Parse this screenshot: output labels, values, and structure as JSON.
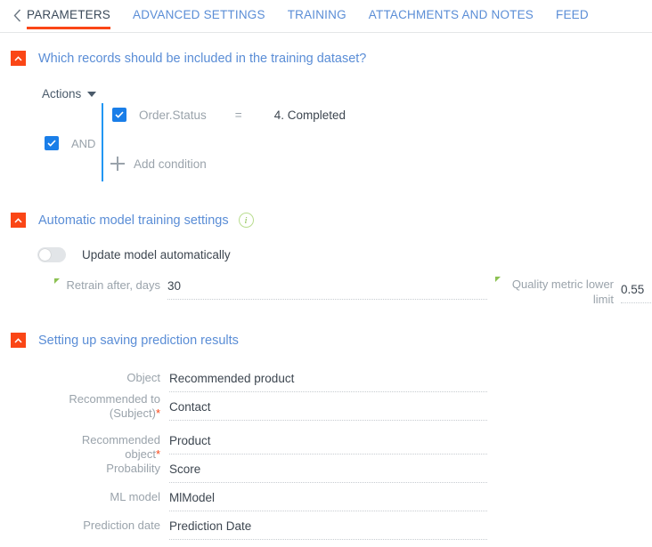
{
  "tabbar": {
    "back_icon": "chevron-left-icon",
    "tabs": [
      {
        "label": "PARAMETERS",
        "active": true
      },
      {
        "label": "ADVANCED SETTINGS",
        "active": false
      },
      {
        "label": "TRAINING",
        "active": false
      },
      {
        "label": "ATTACHMENTS AND NOTES",
        "active": false
      },
      {
        "label": "FEED",
        "active": false
      }
    ]
  },
  "colors": {
    "accent_orange": "#fa4616",
    "link_blue": "#5a8dd6",
    "checkbox_blue": "#1a7ee8",
    "rail_blue": "#2196f3",
    "green": "#8cc152",
    "label_gray": "#9aa3ab",
    "value_dark": "#3d4650"
  },
  "sections": {
    "training_dataset": {
      "title": "Which records should be included in the training dataset?",
      "collapse_icon": "chevron-up-icon",
      "actions_label": "Actions",
      "condition": {
        "checkbox_checked": true,
        "field": "Order.Status",
        "operator": "=",
        "value": "4. Completed"
      },
      "logical": {
        "checkbox_checked": true,
        "label": "AND"
      },
      "add_condition_label": "Add condition"
    },
    "auto_training": {
      "title": "Automatic model training settings",
      "collapse_icon": "chevron-up-icon",
      "info_icon": "info-icon",
      "toggle": {
        "label": "Update model automatically",
        "on": false
      },
      "retrain": {
        "label": "Retrain after, days",
        "value": "30"
      },
      "quality_metric": {
        "label_line1": "Quality metric lower",
        "label_line2": "limit",
        "value": "0.55"
      }
    },
    "saving_results": {
      "title": "Setting up saving prediction results",
      "collapse_icon": "chevron-up-icon",
      "fields": [
        {
          "label": "Object",
          "required": false,
          "value": "Recommended product"
        },
        {
          "label": "Recommended to (Subject)",
          "required": true,
          "value": "Contact"
        },
        {
          "label": "Recommended object",
          "required": true,
          "value": "Product"
        },
        {
          "label": "Probability",
          "required": false,
          "value": "Score"
        },
        {
          "label": "ML model",
          "required": false,
          "value": "MlModel"
        },
        {
          "label": "Prediction date",
          "required": false,
          "value": "Prediction Date"
        }
      ]
    }
  }
}
